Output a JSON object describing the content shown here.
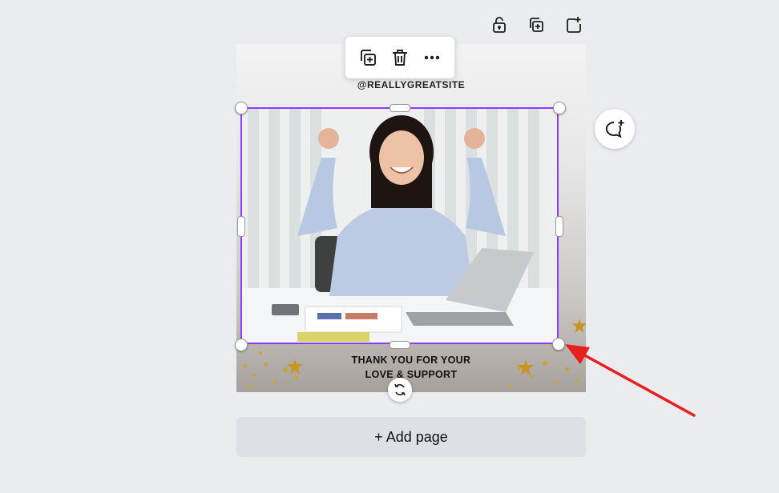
{
  "top_toolbar": {
    "icons": [
      "lock-icon",
      "duplicate-page-icon",
      "add-page-icon"
    ]
  },
  "context_menu": {
    "icons": [
      "duplicate-icon",
      "trash-icon",
      "more-icon"
    ]
  },
  "design": {
    "handle": "@REALLYGREATSITE",
    "thanks_line1": "THANK YOU FOR YOUR",
    "thanks_line2": "LOVE & SUPPORT"
  },
  "comment_button": {
    "icon": "add-comment-icon"
  },
  "rotate_button": {
    "icon": "rotate-icon"
  },
  "add_page": {
    "label": "+ Add page"
  },
  "colors": {
    "selection": "#8b3dff",
    "annotation_arrow": "#e81f1f",
    "canvas_bg": "#ebecf0",
    "confetti_gold": "#c9a43a"
  }
}
